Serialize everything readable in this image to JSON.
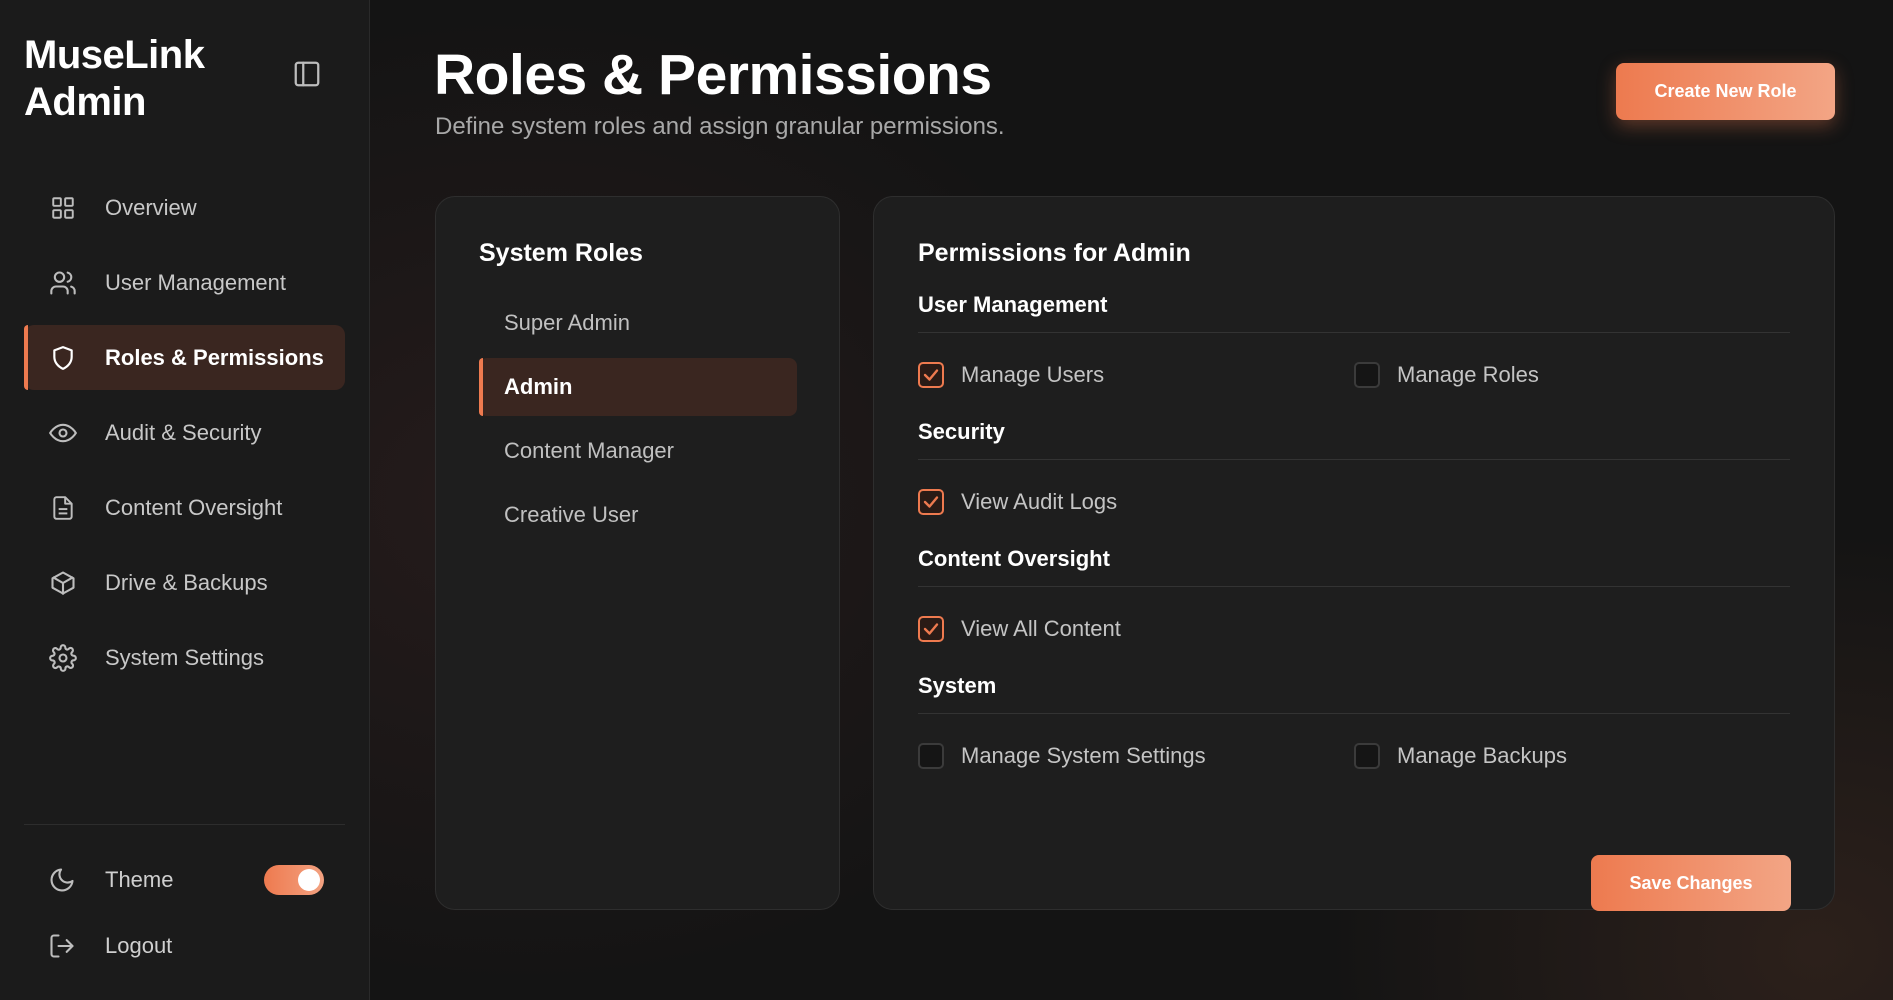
{
  "brand": {
    "line1": "MuseLink",
    "line2": "Admin"
  },
  "sidebar": {
    "items": [
      {
        "label": "Overview",
        "icon": "grid-icon"
      },
      {
        "label": "User Management",
        "icon": "users-icon"
      },
      {
        "label": "Roles & Permissions",
        "icon": "shield-icon",
        "active": true
      },
      {
        "label": "Audit & Security",
        "icon": "eye-icon"
      },
      {
        "label": "Content Oversight",
        "icon": "file-icon"
      },
      {
        "label": "Drive & Backups",
        "icon": "box-icon"
      },
      {
        "label": "System Settings",
        "icon": "gear-icon"
      }
    ],
    "theme_label": "Theme",
    "theme_toggle_on": true,
    "logout_label": "Logout"
  },
  "header": {
    "title": "Roles & Permissions",
    "subtitle": "Define system roles and assign granular permissions.",
    "create_button": "Create New Role"
  },
  "roles": {
    "title": "System Roles",
    "items": [
      "Super Admin",
      "Admin",
      "Content Manager",
      "Creative User"
    ],
    "selected": "Admin"
  },
  "permissions": {
    "title": "Permissions for Admin",
    "groups": [
      {
        "title": "User Management",
        "items": [
          {
            "label": "Manage Users",
            "checked": true
          },
          {
            "label": "Manage Roles",
            "checked": false
          }
        ]
      },
      {
        "title": "Security",
        "items": [
          {
            "label": "View Audit Logs",
            "checked": true
          }
        ]
      },
      {
        "title": "Content Oversight",
        "items": [
          {
            "label": "View All Content",
            "checked": true
          }
        ]
      },
      {
        "title": "System",
        "items": [
          {
            "label": "Manage System Settings",
            "checked": false
          },
          {
            "label": "Manage Backups",
            "checked": false
          }
        ]
      }
    ],
    "save_button": "Save Changes"
  },
  "colors": {
    "accent": "#ee7a4f",
    "accent_light": "#f3a585",
    "active_bg": "#3a2620"
  }
}
